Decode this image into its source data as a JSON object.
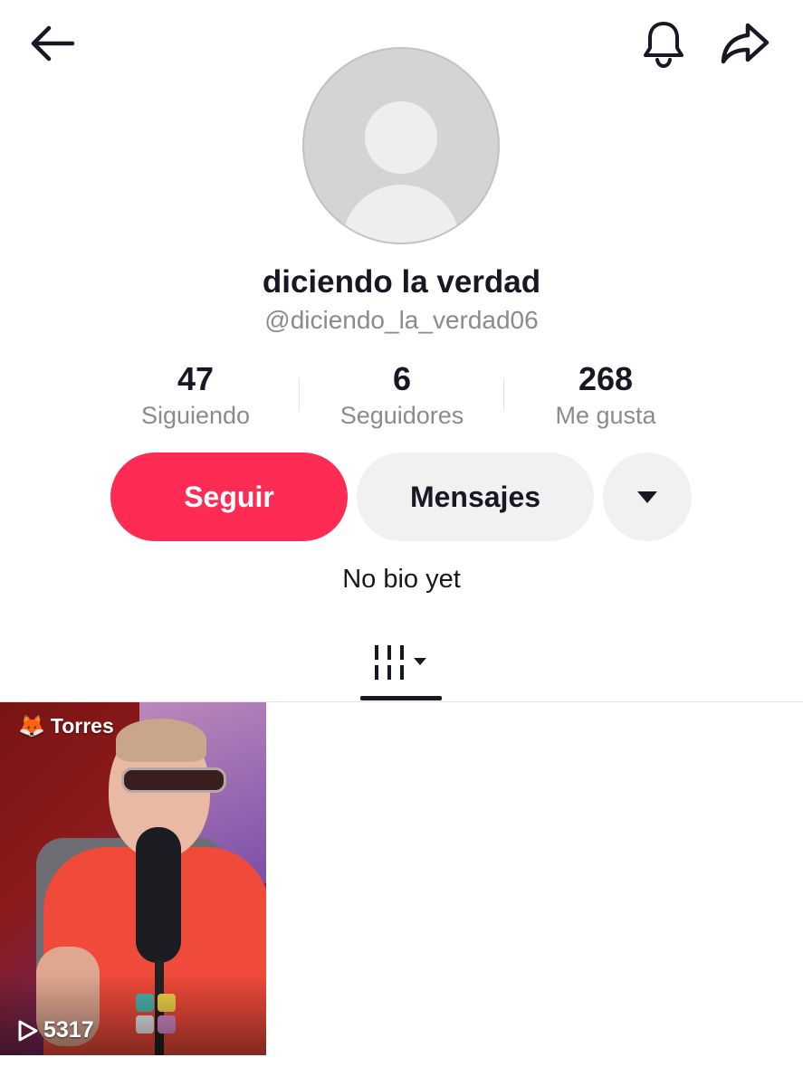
{
  "header": {
    "back_icon": "arrow-left-icon",
    "notification_icon": "bell-icon",
    "share_icon": "share-arrow-icon"
  },
  "profile": {
    "avatar_icon": "default-avatar-icon",
    "display_name": "diciendo la verdad",
    "username": "@diciendo_la_verdad06",
    "bio": "No bio yet"
  },
  "stats": {
    "following": {
      "value": "47",
      "label": "Siguiendo"
    },
    "followers": {
      "value": "6",
      "label": "Seguidores"
    },
    "likes": {
      "value": "268",
      "label": "Me gusta"
    }
  },
  "actions": {
    "follow_label": "Seguir",
    "message_label": "Mensajes",
    "more_icon": "caret-down-icon"
  },
  "tabs": {
    "grid_icon": "grid-videos-icon",
    "grid_dropdown_icon": "caret-down-icon"
  },
  "videos": [
    {
      "label": "Torres",
      "label_icon": "fox-emoji-icon",
      "play_count": "5317",
      "play_icon": "play-outline-icon"
    }
  ],
  "colors": {
    "accent": "#fe2c55",
    "secondary_button": "#f1f1f2",
    "text_primary": "#161823",
    "text_secondary": "#8a8b91"
  }
}
